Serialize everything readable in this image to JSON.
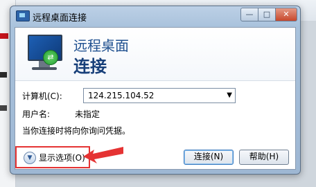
{
  "window": {
    "title": "远程桌面连接",
    "controls": {
      "minimize": "—",
      "maximize": "□",
      "close": "✕"
    }
  },
  "banner": {
    "line1": "远程桌面",
    "line2": "连接"
  },
  "form": {
    "computer_label": "计算机(C):",
    "computer_value": "124.215.104.52",
    "username_label": "用户名:",
    "username_value": "未指定",
    "hint": "当你连接时将向你询问凭据。"
  },
  "footer": {
    "options_label": "显示选项(O)",
    "connect_label": "连接(N)",
    "help_label": "帮助(H)"
  },
  "annotation": {
    "color": "#e53333"
  },
  "icons": {
    "title": "remote-desktop-icon",
    "banner": "monitor-icon",
    "dropdown": "dropdown-arrow-icon",
    "options": "expand-arrow-icon"
  }
}
